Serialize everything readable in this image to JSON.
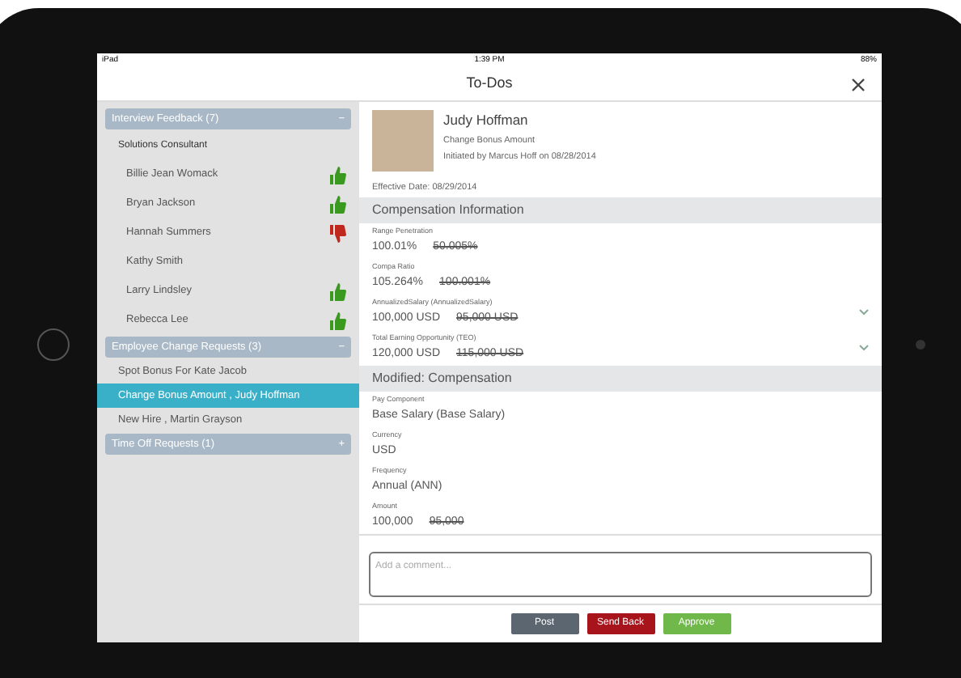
{
  "status_bar": {
    "device": "iPad",
    "time": "1:39 PM",
    "battery": "88%"
  },
  "title": "To-Dos",
  "sidebar": {
    "sections": [
      {
        "title": "Interview Feedback (7)",
        "toggle": "−",
        "subheading": "Solutions Consultant",
        "items": [
          {
            "label": "Billie Jean Womack",
            "kind": "thumbs_up",
            "selected": false
          },
          {
            "label": "Bryan Jackson",
            "kind": "thumbs_up",
            "selected": false
          },
          {
            "label": "Hannah Summers",
            "kind": "thumbs_down",
            "selected": false
          },
          {
            "label": "Kathy Smith",
            "kind": "plain",
            "selected": false
          },
          {
            "label": "Larry Lindsley",
            "kind": "thumbs_up",
            "selected": false
          },
          {
            "label": "Rebecca Lee",
            "kind": "thumbs_up",
            "selected": false
          }
        ]
      },
      {
        "title": "Employee Change Requests (3)",
        "toggle": "−",
        "items": [
          {
            "label": "Spot Bonus For Kate Jacob",
            "kind": "plain",
            "selected": false
          },
          {
            "label": "Change Bonus Amount , Judy Hoffman",
            "kind": "plain",
            "selected": true
          },
          {
            "label": "New Hire , Martin Grayson",
            "kind": "plain",
            "selected": false
          }
        ]
      },
      {
        "title": "Time Off Requests (1)",
        "toggle": "+"
      }
    ]
  },
  "detail": {
    "name": "Judy Hoffman",
    "request": "Change Bonus Amount",
    "initiated": "Initiated by Marcus Hoff on 08/28/2014",
    "effective_date": "Effective Date: 08/29/2014",
    "sections": [
      {
        "title": "Compensation Information",
        "fields": [
          {
            "label": "Range Penetration",
            "value": "100.01%",
            "old_value": "50.005%",
            "expandable": false
          },
          {
            "label": "Compa Ratio",
            "value": "105.264%",
            "old_value": "100.001%",
            "expandable": false
          },
          {
            "label": "AnnualizedSalary (AnnualizedSalary)",
            "value": "100,000 USD",
            "old_value": "95,000 USD",
            "expandable": true
          },
          {
            "label": "Total Earning Opportunity (TEO)",
            "value": "120,000 USD",
            "old_value": "115,000 USD",
            "expandable": true
          }
        ]
      },
      {
        "title": "Modified: Compensation",
        "fields": [
          {
            "label": "Pay Component",
            "value": "Base Salary (Base Salary)",
            "expandable": false
          },
          {
            "label": "Currency",
            "value": "USD",
            "expandable": false
          },
          {
            "label": "Frequency",
            "value": "Annual (ANN)",
            "expandable": false
          },
          {
            "label": "Amount",
            "value": "100,000",
            "old_value": "95,000",
            "expandable": false
          }
        ]
      }
    ]
  },
  "comment": {
    "placeholder": "Add a comment..."
  },
  "buttons": [
    {
      "label": "Post",
      "kind": "neutral"
    },
    {
      "label": "Send Back",
      "kind": "reject"
    },
    {
      "label": "Approve",
      "kind": "approve"
    }
  ]
}
